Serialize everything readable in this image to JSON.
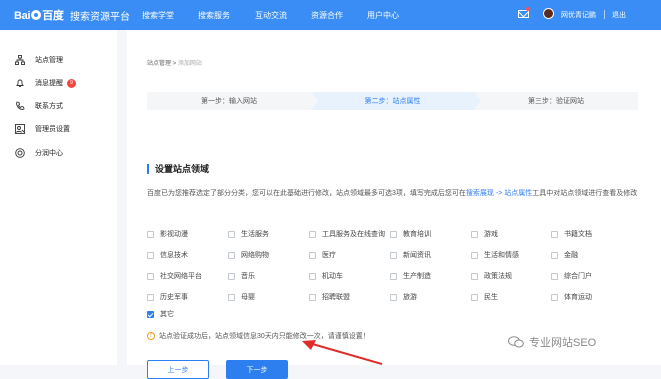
{
  "topbar": {
    "logo_text": "Bai",
    "logo_text2": "百度",
    "logo_sub": "搜索资源平台",
    "nav": [
      "搜索学堂",
      "搜索服务",
      "互动交流",
      "资源合作",
      "用户中心"
    ],
    "user": "网优青记鹏",
    "logout": "退出"
  },
  "sidebar": {
    "items": [
      {
        "label": "站点管理",
        "icon": "sitemap-icon"
      },
      {
        "label": "消息提醒",
        "icon": "bell-icon",
        "badge": "9"
      },
      {
        "label": "联系方式",
        "icon": "phone-icon"
      },
      {
        "label": "管理员设置",
        "icon": "admin-icon"
      },
      {
        "label": "分润中心",
        "icon": "coin-icon"
      }
    ]
  },
  "breadcrumb": {
    "parent": "站点管理",
    "sep": ">",
    "current": "添加网站"
  },
  "steps": [
    {
      "label": "第一步：输入网站",
      "active": false
    },
    {
      "label": "第二步：站点属性",
      "active": true
    },
    {
      "label": "第三步：验证网站",
      "active": false
    }
  ],
  "section": {
    "title": "设置站点领域",
    "desc_part1": "百度已为您推荐选定了部分分类，您可以在此基础进行修改，站点领域最多可选3项，填写完成后您可在",
    "link1": "搜索展现",
    "arrow": " -> ",
    "link2": "站点属性",
    "desc_part2": "工具中对站点领域进行查看及修改"
  },
  "options": [
    [
      "影视动漫",
      "生活服务",
      "工具服务及在线查询",
      "教育培训",
      "游戏",
      "书籍文档"
    ],
    [
      "信息技术",
      "网络购物",
      "医疗",
      "新闻资讯",
      "生活和情感",
      "金融"
    ],
    [
      "社交网络平台",
      "音乐",
      "机动车",
      "生产制造",
      "政策法规",
      "综合门户"
    ],
    [
      "历史军事",
      "母婴",
      "招聘联盟",
      "旅游",
      "民生",
      "体育运动"
    ]
  ],
  "other_option": {
    "label": "其它",
    "checked": true
  },
  "notice": {
    "icon": "!",
    "text": "站点验证成功后，站点领域信息30天内只能修改一次，请谨慎设置！"
  },
  "buttons": {
    "prev": "上一步",
    "next": "下一步"
  },
  "watermark": "专业网站SEO",
  "colors": {
    "primary": "#2d7ff0",
    "topbar": "#3a8df4",
    "badge": "#f0483e",
    "arrow": "#e02b2b"
  }
}
